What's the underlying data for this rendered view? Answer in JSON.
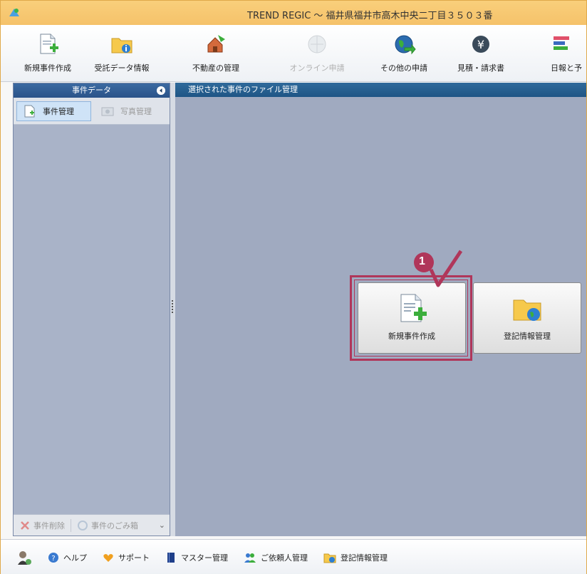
{
  "window": {
    "title": "TREND REGIC ～ 福井県福井市高木中央二丁目３５０３番"
  },
  "toolbar": {
    "items": [
      {
        "label": "新規事件作成",
        "icon": "new-doc-icon",
        "enabled": true
      },
      {
        "label": "受託データ情報",
        "icon": "folder-info-icon",
        "enabled": true
      },
      {
        "label": "不動産の管理",
        "icon": "real-estate-icon",
        "enabled": true
      },
      {
        "label": "オンライン申請",
        "icon": "online-globe-icon",
        "enabled": false
      },
      {
        "label": "その他の申請",
        "icon": "globe-arrow-icon",
        "enabled": true
      },
      {
        "label": "見積・請求書",
        "icon": "yen-icon",
        "enabled": true
      },
      {
        "label": "日報と予",
        "icon": "calendar-bars-icon",
        "enabled": true
      }
    ]
  },
  "left_panel": {
    "header": "事件データ",
    "tabs": [
      {
        "label": "事件管理",
        "active": true
      },
      {
        "label": "写真管理",
        "active": false
      }
    ],
    "bottom": {
      "delete_label": "事件削除",
      "trash_label": "事件のごみ箱"
    }
  },
  "main": {
    "header": "選択された事件のファイル管理",
    "buttons": [
      {
        "label": "新規事件作成",
        "icon": "new-doc-icon"
      },
      {
        "label": "登記情報管理",
        "icon": "folder-globe-icon"
      }
    ],
    "callout_number": "1"
  },
  "statusbar": {
    "items": [
      {
        "label": "",
        "icon": "user-settings-icon"
      },
      {
        "label": "ヘルプ",
        "icon": "help-icon"
      },
      {
        "label": "サポート",
        "icon": "heart-icon"
      },
      {
        "label": "マスター管理",
        "icon": "book-icon"
      },
      {
        "label": "ご依頼人管理",
        "icon": "people-icon"
      },
      {
        "label": "登記情報管理",
        "icon": "folder-globe-icon"
      }
    ]
  },
  "colors": {
    "titlebar": "#f5c26a",
    "panel_header": "#2a5389",
    "workspace": "#a0aac0",
    "highlight": "#b0365a"
  }
}
